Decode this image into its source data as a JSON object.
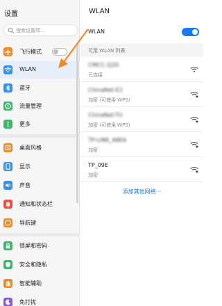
{
  "sidebar": {
    "title": "设置",
    "search_placeholder": "搜索设置项...",
    "items": [
      {
        "label": "飞行模式",
        "icon": "airplane-icon",
        "color": "#f08a24"
      },
      {
        "label": "WLAN",
        "icon": "wifi-icon",
        "color": "#3b8fe8"
      },
      {
        "label": "蓝牙",
        "icon": "bluetooth-icon",
        "color": "#3b8fe8"
      },
      {
        "label": "流量管理",
        "icon": "data-usage-icon",
        "color": "#3fb66b"
      },
      {
        "label": "更多",
        "icon": "more-icon",
        "color": "#3fb66b"
      },
      {
        "label": "桌面风格",
        "icon": "home-icon",
        "color": "#f08a24"
      },
      {
        "label": "显示",
        "icon": "display-icon",
        "color": "#3b8fe8"
      },
      {
        "label": "声音",
        "icon": "sound-icon",
        "color": "#3b8fe8"
      },
      {
        "label": "通知和状态栏",
        "icon": "notification-icon",
        "color": "#f04e3e"
      },
      {
        "label": "导航键",
        "icon": "navigation-key-icon",
        "color": "#f08a24"
      },
      {
        "label": "锁屏和密码",
        "icon": "lock-icon",
        "color": "#3fb66b"
      },
      {
        "label": "安全和隐私",
        "icon": "shield-icon",
        "color": "#3fb66b"
      },
      {
        "label": "智能辅助",
        "icon": "hand-icon",
        "color": "#f08a24"
      },
      {
        "label": "免打扰",
        "icon": "moon-icon",
        "color": "#8b5cd6"
      }
    ]
  },
  "main": {
    "title": "WLAN",
    "wlan_label": "WLAN",
    "wlan_enabled": true,
    "list_header": "可用 WLAN 列表",
    "networks": [
      {
        "name": "CMCC-2J20",
        "status": "已连接",
        "connected": true
      },
      {
        "name": "ChinaNet-E2",
        "status": "加密 (可使用 WPS)",
        "connected": false
      },
      {
        "name": "ChinaNet-TU",
        "status": "加密 (可使用 WPS)",
        "connected": false
      },
      {
        "name": "TP-LINK_A8E6",
        "status": "加密",
        "connected": false
      },
      {
        "name": "TP_09E",
        "status": "加密",
        "connected": false
      }
    ],
    "add_network": "添加其他网络···"
  },
  "colors": {
    "accent": "#1a7ae8",
    "annotation_arrow": "#f08a24"
  }
}
